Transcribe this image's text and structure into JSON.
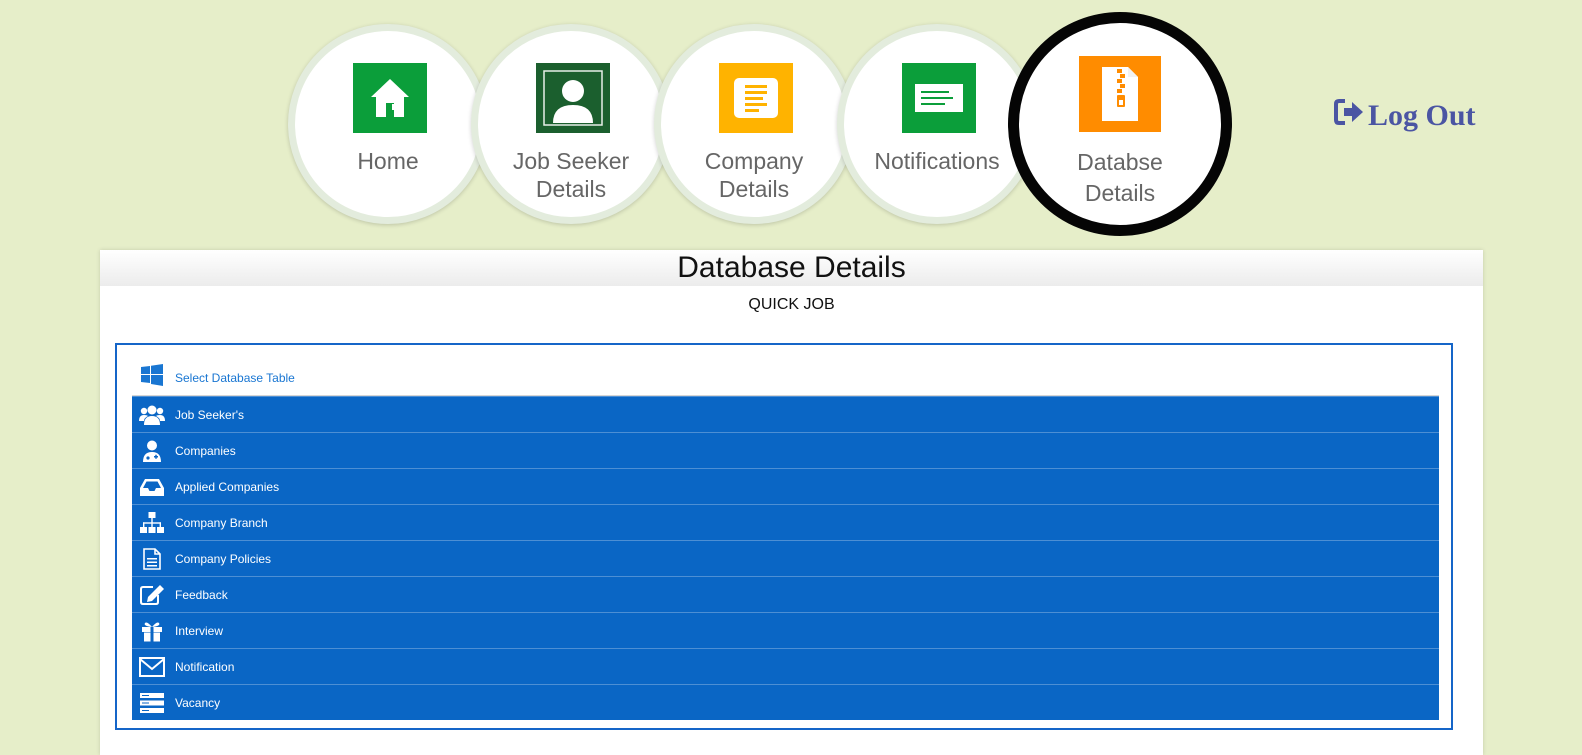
{
  "nav": {
    "items": [
      {
        "label_line1": "Home",
        "label_line2": "",
        "icon": "home-icon",
        "color": "#0b9e3a"
      },
      {
        "label_line1": "Job Seeker",
        "label_line2": "Details",
        "icon": "user-icon",
        "color": "#1b5f2e"
      },
      {
        "label_line1": "Company",
        "label_line2": "Details",
        "icon": "document-icon",
        "color": "#ffb300"
      },
      {
        "label_line1": "Notifications",
        "label_line2": "",
        "icon": "message-icon",
        "color": "#0b9e3a"
      },
      {
        "label_line1": "Databse",
        "label_line2": "Details",
        "icon": "zip-file-icon",
        "color": "#ff8c00",
        "active": true
      }
    ]
  },
  "logout": {
    "label": "Log Out",
    "icon": "sign-out-icon",
    "color": "#4b55a3"
  },
  "panel": {
    "title": "Database Details",
    "subtitle": "QUICK JOB"
  },
  "table_list": {
    "header": "Select Database Table",
    "header_icon": "windows-icon",
    "items": [
      {
        "label": "Job Seeker's",
        "icon": "users-icon"
      },
      {
        "label": "Companies",
        "icon": "user-doctor-icon"
      },
      {
        "label": "Applied Companies",
        "icon": "inbox-icon"
      },
      {
        "label": "Company Branch",
        "icon": "sitemap-icon"
      },
      {
        "label": "Company Policies",
        "icon": "file-icon"
      },
      {
        "label": "Feedback",
        "icon": "edit-icon"
      },
      {
        "label": "Interview",
        "icon": "gift-icon"
      },
      {
        "label": "Notification",
        "icon": "envelope-icon"
      },
      {
        "label": "Vacancy",
        "icon": "server-icon"
      }
    ]
  },
  "colors": {
    "background": "#e6eec9",
    "row": "#0a66c5",
    "border": "#1565c8"
  }
}
